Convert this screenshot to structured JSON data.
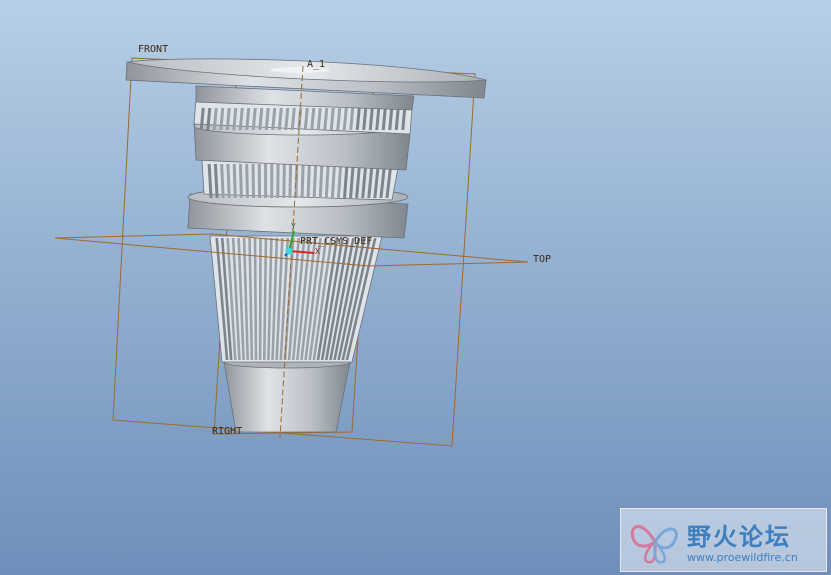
{
  "viewport": {
    "background_top": "#b7cfe6",
    "background_bottom": "#6f8fba",
    "datum_color": "#a06a2c",
    "model_color": "#c9ced3"
  },
  "datums": {
    "front": "FRONT",
    "top": "TOP",
    "right": "RIGHT",
    "axis": "A_1",
    "csys": "PRT_CSYS_DEF",
    "csys_y": "Y",
    "csys_x": "X"
  },
  "watermark": {
    "title": "野火论坛",
    "url": "www.proewildfire.cn",
    "icon": "butterfly-logo-icon"
  }
}
